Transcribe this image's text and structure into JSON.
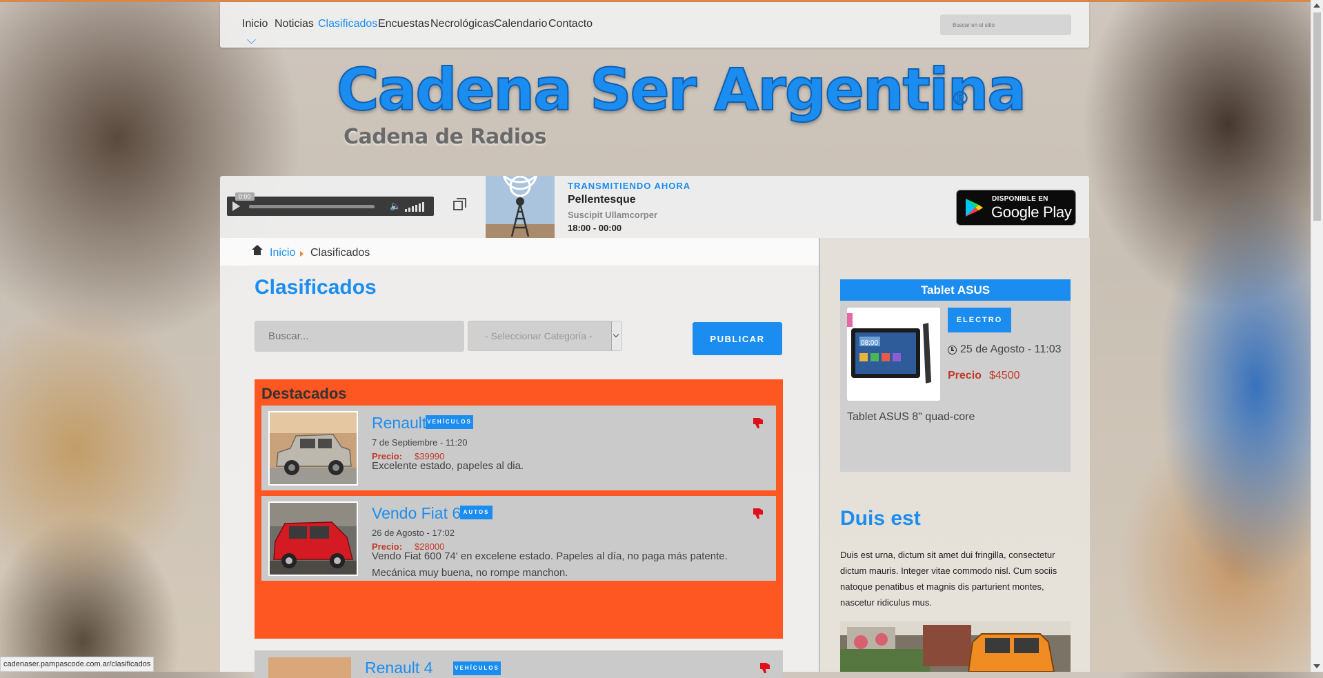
{
  "nav": {
    "items": [
      {
        "label": "Inicio",
        "active": false
      },
      {
        "label": "Noticias",
        "active": false
      },
      {
        "label": "Clasificados",
        "active": true
      },
      {
        "label": "Encuestas",
        "active": false
      },
      {
        "label": "Necrológicas",
        "active": false
      },
      {
        "label": "Calendario",
        "active": false
      },
      {
        "label": "Contacto",
        "active": false
      }
    ],
    "search_placeholder": "Buscar en el sitio"
  },
  "brand": {
    "title": "Cadena Ser Argentina",
    "registered": "®",
    "subtitle": "Cadena de Radios",
    "color": "#1b8df0"
  },
  "player": {
    "time": "0:00",
    "now_playing_label": "TRANSMITIENDO AHORA",
    "show_title": "Pellentesque",
    "show_host": "Suscipit Ullamcorper",
    "show_time": "18:00 - 00:00",
    "store_small": "DISPONIBLE EN",
    "store_big": "Google Play"
  },
  "breadcrumb": {
    "home": "Inicio",
    "current": "Clasificados"
  },
  "page": {
    "title": "Clasificados",
    "search_placeholder": "Buscar...",
    "category_select": "- Seleccionar Categoría -",
    "publish_label": "PUBLICAR"
  },
  "featured": {
    "title": "Destacados",
    "accent": "#ff5722",
    "items": [
      {
        "title": "Renault 4",
        "badge": "VEHÍCULOS",
        "date": "7 de Septiembre - 11:20",
        "price_label": "Precio:",
        "price": "$39990",
        "description": "Excelente estado, papeles al dia."
      },
      {
        "title": "Vendo Fiat 600",
        "badge": "AUTOS",
        "date": "26 de Agosto - 17:02",
        "price_label": "Precio:",
        "price": "$28000",
        "description": "Vendo Fiat 600 74' en excelene estado. Papeles al día, no paga más patente. Mecánica muy buena, no rompe manchon."
      }
    ]
  },
  "listing_peek": {
    "title": "Renault 4",
    "badge": "VEHÍCULOS"
  },
  "sidebar": {
    "widget": {
      "title": "Tablet ASUS",
      "badge": "ELECTRO",
      "date": "25 de Agosto - 11:03",
      "price_label": "Precio",
      "price": "$4500",
      "description": "Tablet ASUS 8\" quad-core"
    },
    "section_title": "Duis est",
    "section_text": "Duis est urna, dictum sit amet dui fringilla, consectetur dictum mauris. Integer vitae commodo nisl. Cum sociis natoque penatibus et magnis dis parturient montes, nascetur ridiculus mus."
  },
  "status_bar": {
    "url": "cadenaser.pampascode.com.ar/clasificados"
  }
}
